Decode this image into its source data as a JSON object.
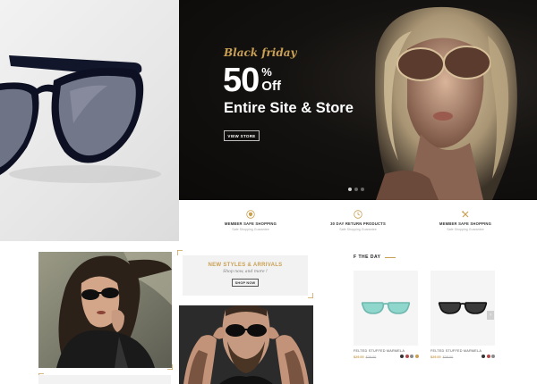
{
  "hero": {
    "tag": "Black friday",
    "percent": "50",
    "percent_sign": "%",
    "off_label": "Off",
    "headline": "Entire Site & Store",
    "button_label": "VIEW STORE",
    "slide_count": 3,
    "active_slide": 0
  },
  "features": [
    {
      "icon": "shield-icon",
      "title": "MEMBER SAFE SHOPPING",
      "subtitle": "Safe Shopping Guarantee"
    },
    {
      "icon": "clock-icon",
      "title": "30 DAY RETURN PRODUCTS",
      "subtitle": "Safe Shopping Guarantee"
    },
    {
      "icon": "tools-icon",
      "title": "MEMBER SAFE SHOPPING",
      "subtitle": "Safe Shopping Guarantee"
    }
  ],
  "promo": {
    "title": "NEW STYLES & ARRIVALS",
    "subtitle": "Shop now, and more !",
    "button_label": "SHOP NOW"
  },
  "products_section": {
    "title": "F THE DAY",
    "products": [
      {
        "name": "FELTED STUFFED MARMELA",
        "price_new": "$29.00",
        "price_old": "$38.00",
        "lens_color": "#8fd6cd",
        "frame_color": "#6fb8ae",
        "swatches": [
          "#333333",
          "#b04a4a",
          "#8a8a8a",
          "#c9a053"
        ]
      },
      {
        "name": "FELTED STUFFED MARMELA",
        "price_new": "$29.00",
        "price_old": "$38.00",
        "lens_color": "#2d2d2d",
        "frame_color": "#111111",
        "swatches": [
          "#333333",
          "#b04a4a",
          "#8a8a8a"
        ]
      }
    ],
    "arrow": "›"
  },
  "colors": {
    "accent": "#c9a053",
    "hero_bg": "#141210",
    "text_dark": "#222222"
  }
}
